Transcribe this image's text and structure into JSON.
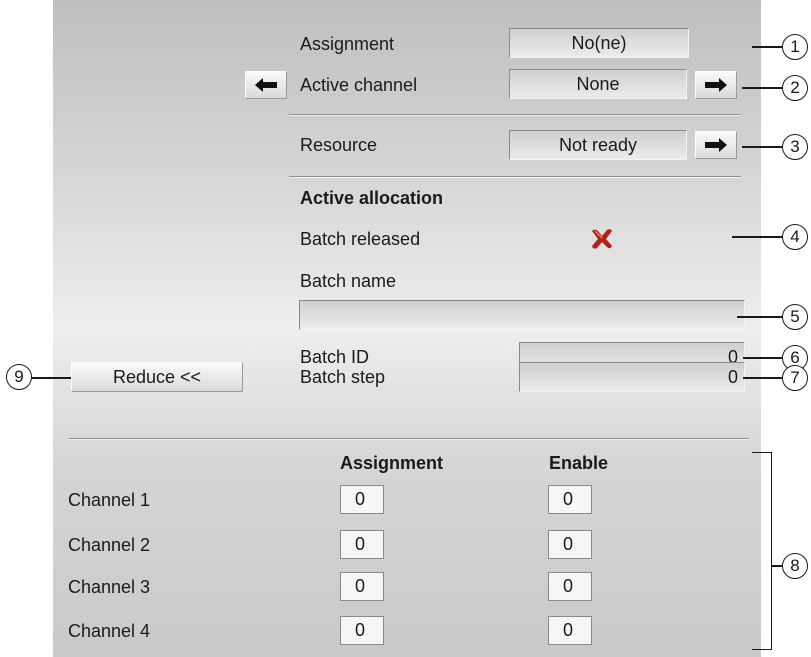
{
  "rows": {
    "assignment": {
      "label": "Assignment",
      "value": "No(ne)"
    },
    "active_channel": {
      "label": "Active channel",
      "value": "None"
    },
    "resource": {
      "label": "Resource",
      "value": "Not ready"
    },
    "active_allocation": {
      "heading": "Active allocation"
    },
    "batch_released": {
      "label": "Batch released",
      "icon": "red-x-icon"
    },
    "batch_name": {
      "label": "Batch name",
      "value": ""
    },
    "batch_id": {
      "label": "Batch ID",
      "value": "0"
    },
    "batch_step": {
      "label": "Batch step",
      "value": "0"
    }
  },
  "reduce_button": {
    "label": "Reduce <<"
  },
  "channel_table": {
    "headers": {
      "assignment": "Assignment",
      "enable": "Enable"
    },
    "rows": [
      {
        "label": "Channel 1",
        "assignment": "0",
        "enable": "0"
      },
      {
        "label": "Channel 2",
        "assignment": "0",
        "enable": "0"
      },
      {
        "label": "Channel 3",
        "assignment": "0",
        "enable": "0"
      },
      {
        "label": "Channel 4",
        "assignment": "0",
        "enable": "0"
      }
    ]
  },
  "callouts": [
    "1",
    "2",
    "3",
    "4",
    "5",
    "6",
    "7",
    "8",
    "9"
  ],
  "colors": {
    "release_icon": "#b3201a",
    "panel_top": "#bfbfbf",
    "panel_mid": "#eeeeee"
  }
}
